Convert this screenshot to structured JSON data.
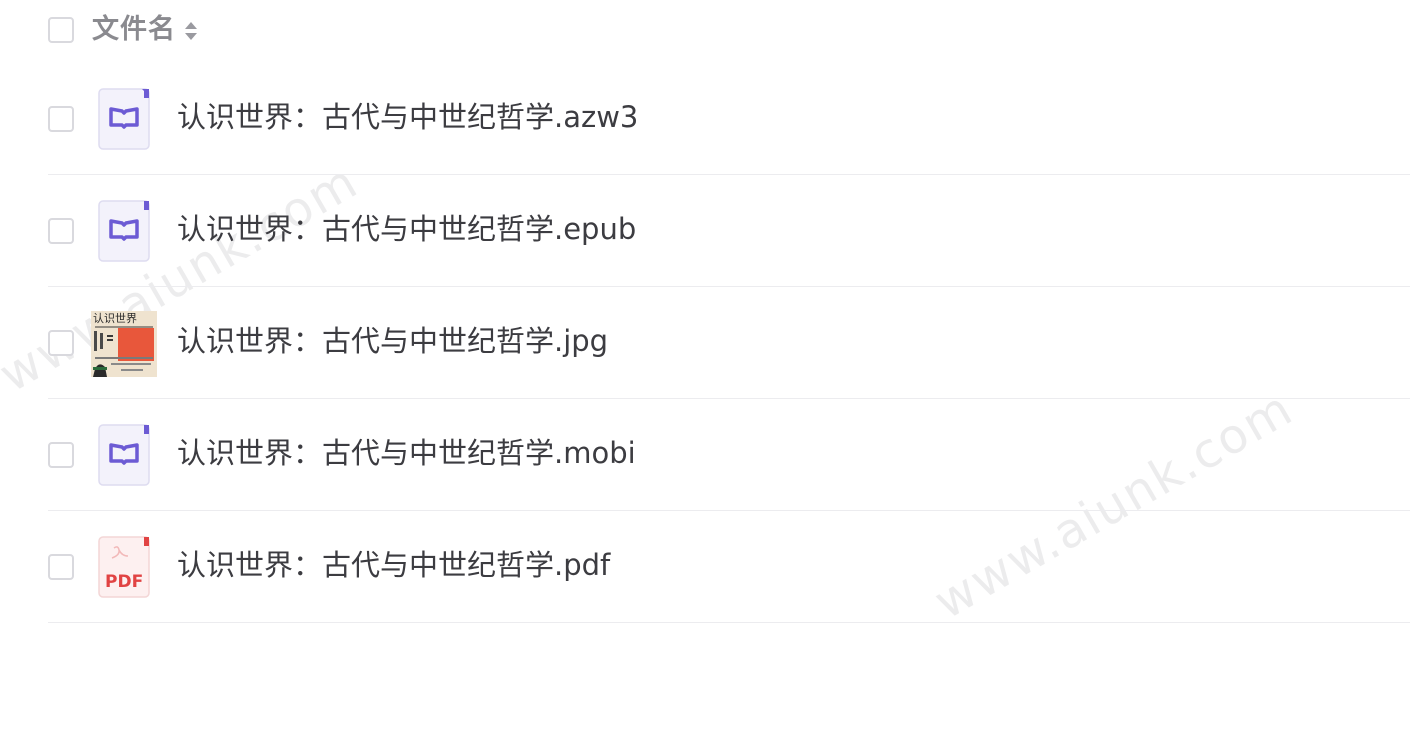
{
  "header": {
    "column_label": "文件名",
    "sort_icon": "sort-icon"
  },
  "files": [
    {
      "name": "认识世界：古代与中世纪哲学.azw3",
      "icon": "ebook-icon"
    },
    {
      "name": "认识世界：古代与中世纪哲学.epub",
      "icon": "ebook-icon"
    },
    {
      "name": "认识世界：古代与中世纪哲学.jpg",
      "icon": "image-thumbnail",
      "thumb_title": "认识世界"
    },
    {
      "name": "认识世界：古代与中世纪哲学.mobi",
      "icon": "ebook-icon"
    },
    {
      "name": "认识世界：古代与中世纪哲学.pdf",
      "icon": "pdf-icon",
      "badge": "PDF"
    }
  ],
  "watermark": "www.aiunk.com",
  "colors": {
    "ebook_accent": "#6c5bd4",
    "ebook_bg": "#f3f2fb",
    "pdf_accent": "#e14343",
    "pdf_bg": "#fdf0f0",
    "thumb_red": "#e8573b",
    "thumb_bg": "#efe3cf"
  }
}
